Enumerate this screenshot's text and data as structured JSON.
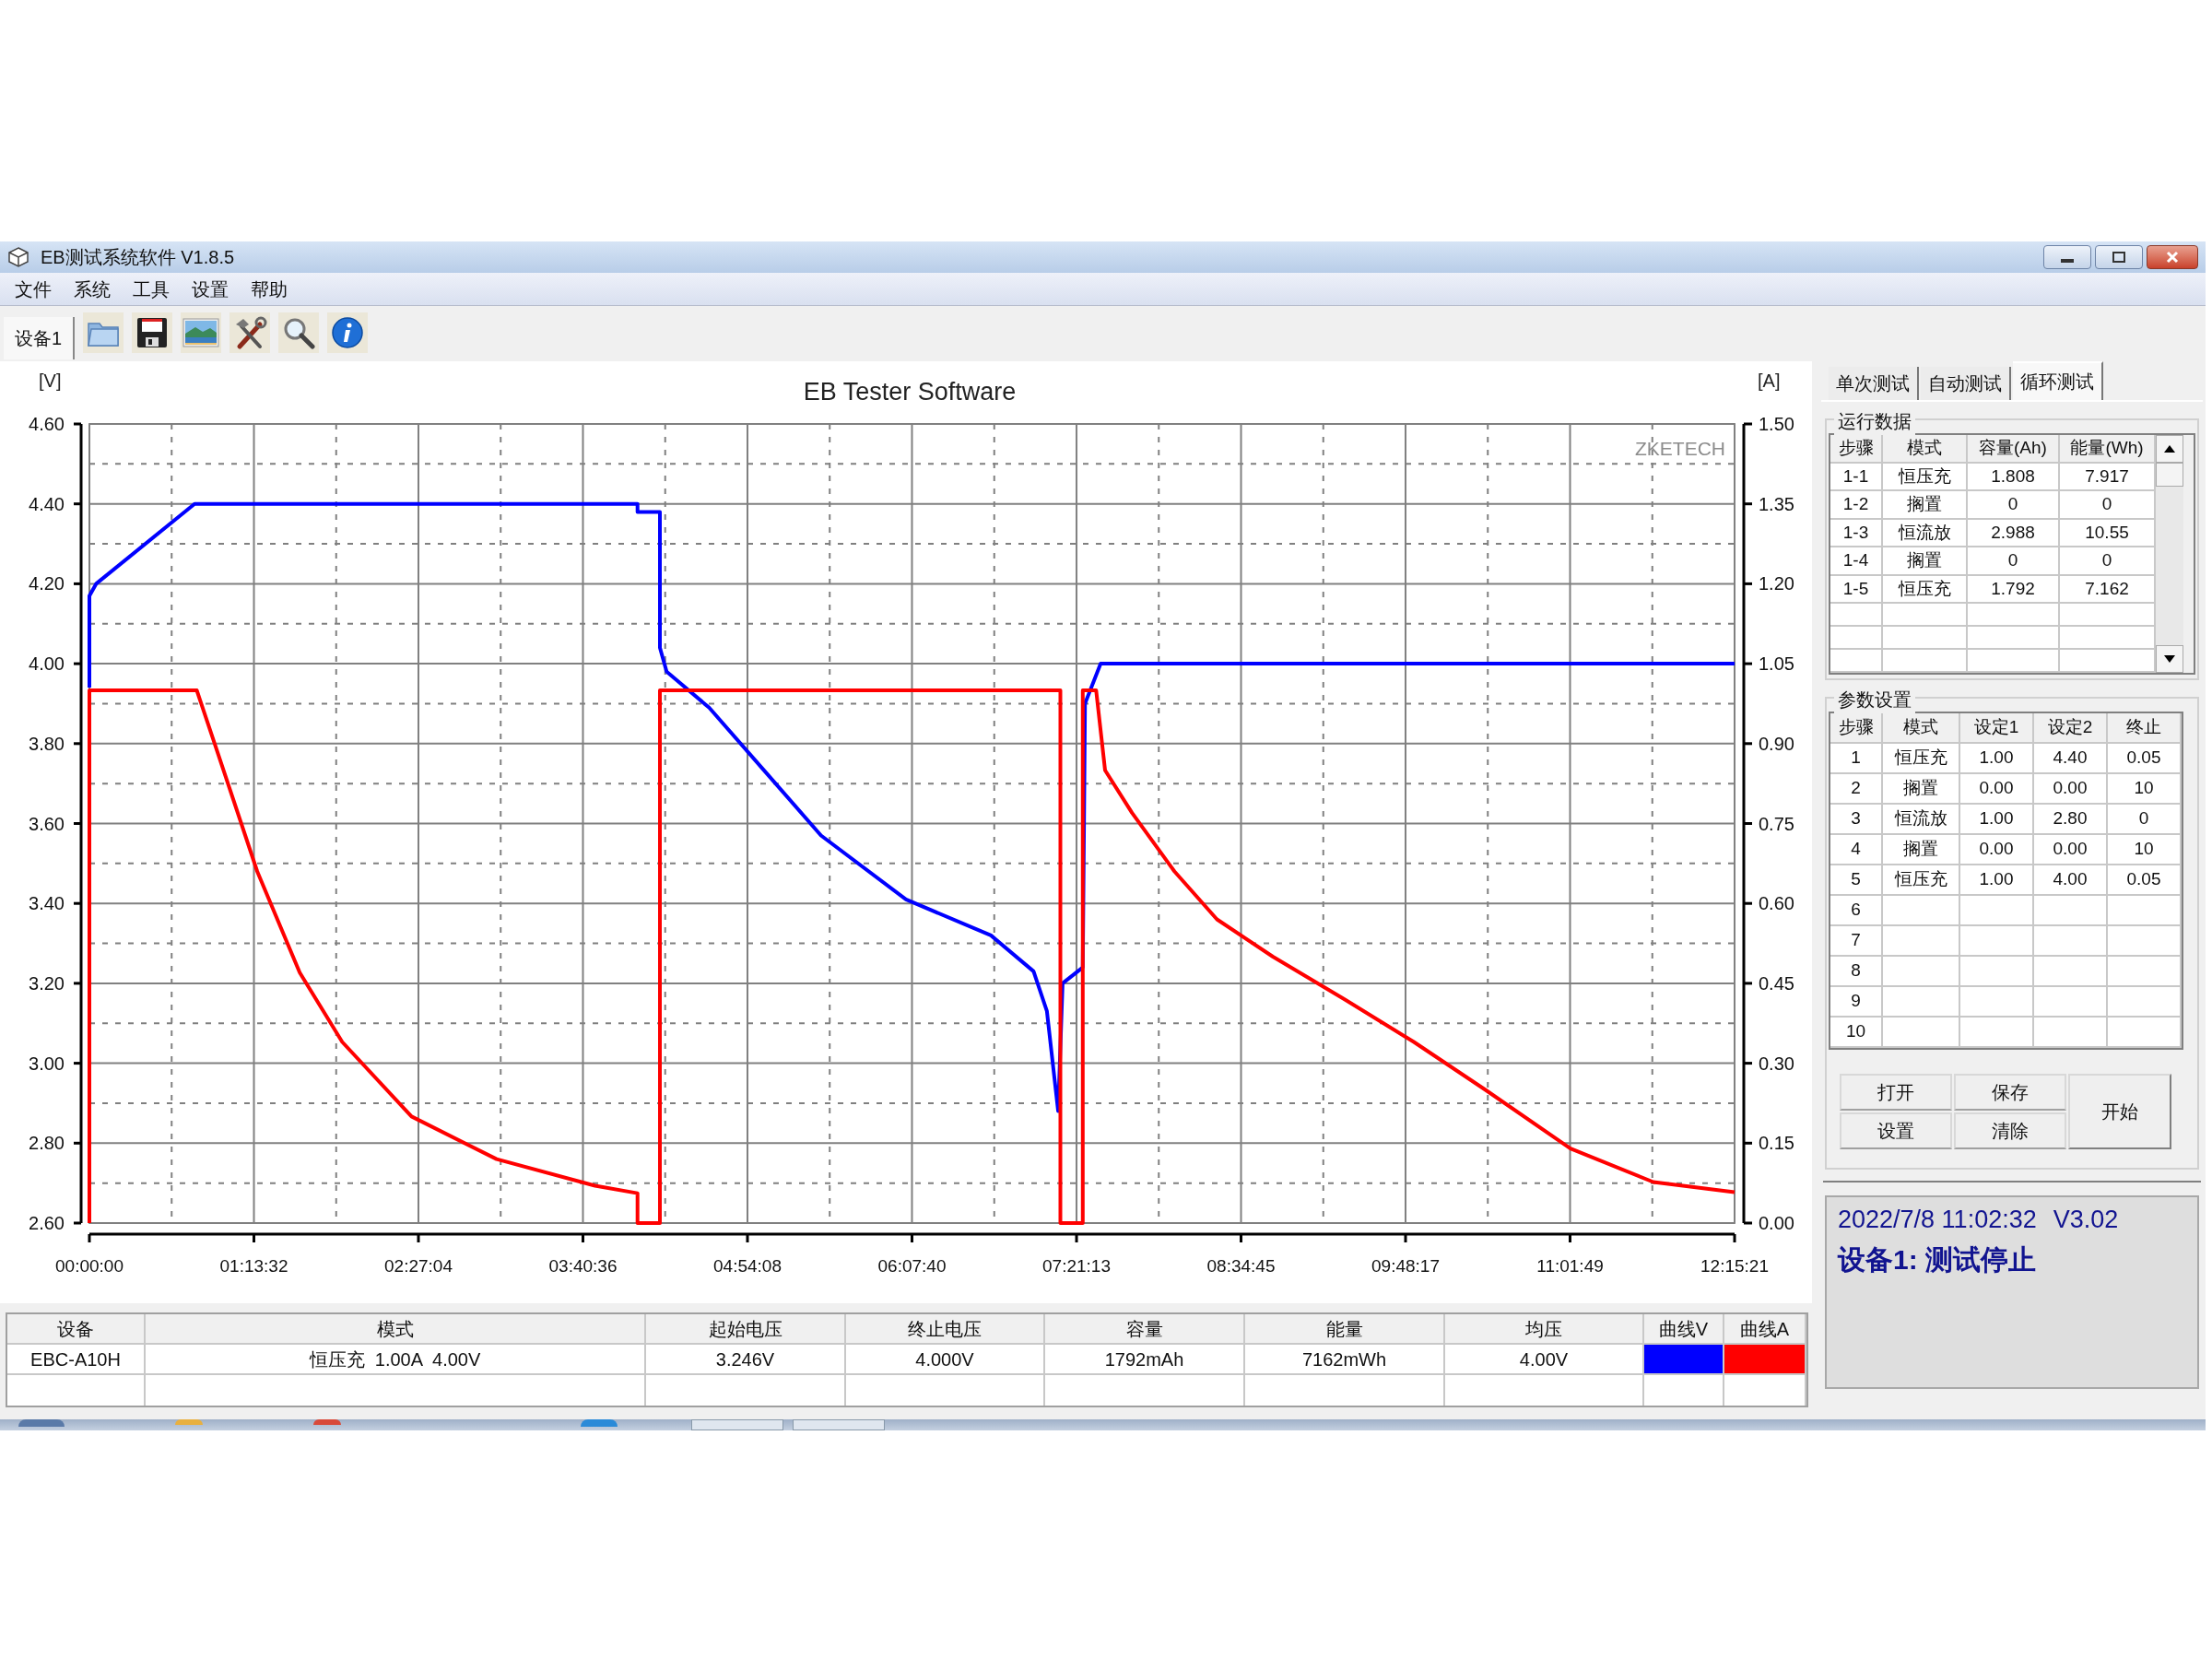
{
  "window": {
    "title": "EB测试系统软件 V1.8.5"
  },
  "menu": [
    "文件",
    "系统",
    "工具",
    "设置",
    "帮助"
  ],
  "device_tabs": [
    {
      "label": "设备1",
      "selected": true
    }
  ],
  "chart": {
    "watermark": "ZKETECH",
    "chart_data": {
      "type": "line",
      "grid": true,
      "title": "EB Tester Software",
      "ylabel": "[V]",
      "y2label": "[A]",
      "xlim": [
        0,
        735.35
      ],
      "ylim": [
        2.6,
        4.6
      ],
      "y2lim": [
        0,
        1.5
      ],
      "xticks": [
        {
          "value": 0,
          "label": "00:00:00"
        },
        {
          "value": 73.54,
          "label": "01:13:32"
        },
        {
          "value": 147.07,
          "label": "02:27:04"
        },
        {
          "value": 220.6,
          "label": "03:40:36"
        },
        {
          "value": 294.14,
          "label": "04:54:08"
        },
        {
          "value": 367.67,
          "label": "06:07:40"
        },
        {
          "value": 441.22,
          "label": "07:21:13"
        },
        {
          "value": 514.75,
          "label": "08:34:45"
        },
        {
          "value": 588.28,
          "label": "09:48:17"
        },
        {
          "value": 661.82,
          "label": "11:01:49"
        },
        {
          "value": 735.35,
          "label": "12:15:21"
        }
      ],
      "yticks": [
        {
          "value": 2.6,
          "label": "2.60"
        },
        {
          "value": 2.8,
          "label": "2.80"
        },
        {
          "value": 3.0,
          "label": "3.00"
        },
        {
          "value": 3.2,
          "label": "3.20"
        },
        {
          "value": 3.4,
          "label": "3.40"
        },
        {
          "value": 3.6,
          "label": "3.60"
        },
        {
          "value": 3.8,
          "label": "3.80"
        },
        {
          "value": 4.0,
          "label": "4.00"
        },
        {
          "value": 4.2,
          "label": "4.20"
        },
        {
          "value": 4.4,
          "label": "4.40"
        },
        {
          "value": 4.6,
          "label": "4.60"
        }
      ],
      "y2ticks": [
        {
          "value": 0,
          "label": "0.00"
        },
        {
          "value": 0.15,
          "label": "0.15"
        },
        {
          "value": 0.3,
          "label": "0.30"
        },
        {
          "value": 0.45,
          "label": "0.45"
        },
        {
          "value": 0.6,
          "label": "0.60"
        },
        {
          "value": 0.75,
          "label": "0.75"
        },
        {
          "value": 0.9,
          "label": "0.90"
        },
        {
          "value": 1.05,
          "label": "1.05"
        },
        {
          "value": 1.2,
          "label": "1.20"
        },
        {
          "value": 1.35,
          "label": "1.35"
        },
        {
          "value": 1.5,
          "label": "1.50"
        }
      ],
      "series": [
        {
          "color": "#0000ff",
          "x": [
            0,
            0,
            3,
            47,
            245,
            245,
            255,
            255,
            258,
            277,
            302,
            327,
            365,
            403,
            422,
            428,
            433,
            435,
            444,
            445,
            452,
            735.35
          ],
          "values": [
            3.94,
            4.17,
            4.2,
            4.4,
            4.4,
            4.38,
            4.38,
            4.04,
            3.98,
            3.89,
            3.73,
            3.57,
            3.41,
            3.32,
            3.23,
            3.13,
            2.88,
            3.2,
            3.24,
            3.9,
            4.0,
            4.0
          ]
        },
        {
          "color": "#ff0000",
          "axis": "y2",
          "x": [
            0,
            0,
            48,
            56,
            75,
            94,
            113,
            144,
            182,
            226,
            245,
            245,
            255,
            255,
            434,
            434,
            444,
            444,
            450,
            454,
            466,
            485,
            504,
            529,
            561,
            592,
            624,
            662,
            699,
            735.35
          ],
          "values": [
            0,
            1.0,
            1.0,
            0.9,
            0.66,
            0.47,
            0.34,
            0.2,
            0.12,
            0.07,
            0.056,
            0,
            0,
            1.0,
            1.0,
            0,
            0,
            1.0,
            1.0,
            0.85,
            0.77,
            0.66,
            0.57,
            0.5,
            0.42,
            0.34,
            0.25,
            0.14,
            0.077,
            0.058
          ]
        }
      ]
    }
  },
  "side_tabs": [
    {
      "label": "单次测试",
      "selected": false
    },
    {
      "label": "自动测试",
      "selected": false
    },
    {
      "label": "循环测试",
      "selected": true
    }
  ],
  "run_data": {
    "title": "运行数据",
    "columns": [
      "步骤",
      "模式",
      "容量(Ah)",
      "能量(Wh)"
    ],
    "rows": [
      [
        "1-1",
        "恒压充",
        "1.808",
        "7.917"
      ],
      [
        "1-2",
        "搁置",
        "0",
        "0"
      ],
      [
        "1-3",
        "恒流放",
        "2.988",
        "10.55"
      ],
      [
        "1-4",
        "搁置",
        "0",
        "0"
      ],
      [
        "1-5",
        "恒压充",
        "1.792",
        "7.162"
      ]
    ]
  },
  "params": {
    "title": "参数设置",
    "columns": [
      "步骤",
      "模式",
      "设定1",
      "设定2",
      "终止"
    ],
    "rows": [
      [
        "1",
        "恒压充",
        "1.00",
        "4.40",
        "0.05"
      ],
      [
        "2",
        "搁置",
        "0.00",
        "0.00",
        "10"
      ],
      [
        "3",
        "恒流放",
        "1.00",
        "2.80",
        "0"
      ],
      [
        "4",
        "搁置",
        "0.00",
        "0.00",
        "10"
      ],
      [
        "5",
        "恒压充",
        "1.00",
        "4.00",
        "0.05"
      ],
      [
        "6"
      ],
      [
        "7"
      ],
      [
        "8"
      ],
      [
        "9"
      ],
      [
        "10"
      ]
    ]
  },
  "buttons": [
    "打开",
    "保存",
    "设置",
    "清除"
  ],
  "start_button": "开始",
  "status": {
    "datetime": "2022/7/8 11:02:32",
    "version": "V3.02",
    "message": "设备1: 测试停止"
  },
  "summary": {
    "columns": [
      "设备",
      "模式",
      "起始电压",
      "终止电压",
      "容量",
      "能量",
      "均压",
      "曲线V",
      "曲线A"
    ],
    "rows": [
      {
        "cells": [
          "EBC-A10H",
          "恒压充  1.00A  4.00V",
          "3.246V",
          "4.000V",
          "1792mAh",
          "7162mWh",
          "4.00V"
        ],
        "curves": [
          {
            "color": "#0000ff"
          },
          {
            "color": "#ff0000"
          }
        ]
      }
    ]
  }
}
